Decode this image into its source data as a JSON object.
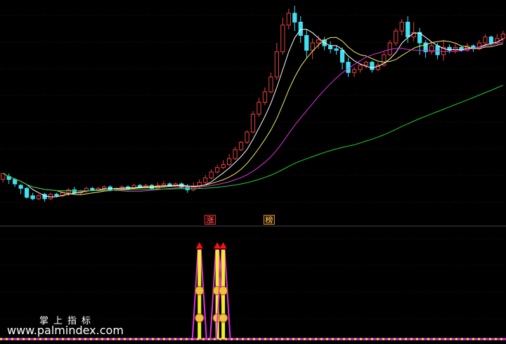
{
  "chart_data": {
    "type": "candlestick",
    "upper_panel": {
      "ylim": [
        0,
        100
      ],
      "grid": true,
      "colors": {
        "up": "#e84040",
        "down": "#40e0f0",
        "ma5": "#ffffff",
        "ma10": "#f0f060",
        "ma20": "#e030e0",
        "ma60": "#20d030"
      },
      "candles": [
        [
          66,
          70,
          64,
          68
        ],
        [
          68,
          66,
          63,
          70
        ],
        [
          66,
          63,
          61,
          67
        ],
        [
          62,
          60,
          56,
          63
        ],
        [
          60,
          54,
          53,
          61
        ],
        [
          55,
          53,
          52,
          57
        ],
        [
          53,
          55,
          52,
          56
        ],
        [
          56,
          53,
          51,
          57
        ],
        [
          53,
          56,
          52,
          57
        ],
        [
          56,
          55,
          54,
          57
        ],
        [
          55,
          57,
          54,
          58
        ],
        [
          57,
          59,
          55,
          60
        ],
        [
          59,
          57,
          56,
          61
        ],
        [
          57,
          58,
          56,
          59
        ],
        [
          58,
          60,
          57,
          61
        ],
        [
          60,
          59,
          58,
          61
        ],
        [
          59,
          60,
          58,
          61
        ],
        [
          60,
          61,
          59,
          62
        ],
        [
          61,
          59,
          58,
          62
        ],
        [
          59,
          60,
          58,
          61
        ],
        [
          60,
          61,
          59,
          62
        ],
        [
          61,
          60,
          59,
          62
        ],
        [
          60,
          62,
          59,
          63
        ],
        [
          62,
          61,
          60,
          63
        ],
        [
          61,
          62,
          60,
          63
        ],
        [
          62,
          60,
          59,
          63
        ],
        [
          60,
          62,
          59,
          64
        ],
        [
          62,
          63,
          61,
          65
        ],
        [
          63,
          62,
          61,
          64
        ],
        [
          62,
          63,
          61,
          64
        ],
        [
          63,
          61,
          60,
          64
        ],
        [
          61,
          59,
          57,
          63
        ],
        [
          59,
          61,
          58,
          64
        ],
        [
          61,
          64,
          60,
          66
        ],
        [
          64,
          67,
          63,
          69
        ],
        [
          67,
          71,
          66,
          73
        ],
        [
          71,
          74,
          70,
          76
        ],
        [
          74,
          76,
          73,
          79
        ],
        [
          76,
          80,
          75,
          83
        ],
        [
          80,
          86,
          79,
          88
        ],
        [
          86,
          91,
          85,
          92
        ],
        [
          91,
          98,
          90,
          99
        ],
        [
          98,
          110,
          97,
          112
        ],
        [
          110,
          118,
          108,
          121
        ],
        [
          118,
          125,
          116,
          128
        ],
        [
          125,
          135,
          124,
          138
        ],
        [
          135,
          152,
          133,
          158
        ],
        [
          152,
          170,
          150,
          175
        ],
        [
          170,
          178,
          167,
          181
        ],
        [
          178,
          172,
          166,
          183
        ],
        [
          172,
          163,
          158,
          176
        ],
        [
          163,
          153,
          148,
          167
        ],
        [
          153,
          158,
          147,
          161
        ],
        [
          158,
          160,
          154,
          163
        ],
        [
          160,
          156,
          153,
          162
        ],
        [
          156,
          154,
          151,
          159
        ],
        [
          154,
          153,
          150,
          156
        ],
        [
          153,
          145,
          140,
          155
        ],
        [
          145,
          138,
          135,
          148
        ],
        [
          138,
          140,
          135,
          142
        ],
        [
          140,
          143,
          138,
          144
        ],
        [
          143,
          145,
          141,
          146
        ],
        [
          145,
          140,
          138,
          146
        ],
        [
          140,
          143,
          139,
          145
        ],
        [
          143,
          150,
          142,
          152
        ],
        [
          150,
          158,
          149,
          160
        ],
        [
          158,
          166,
          156,
          168
        ],
        [
          166,
          172,
          163,
          174
        ],
        [
          172,
          162,
          158,
          176
        ],
        [
          162,
          165,
          159,
          172
        ],
        [
          165,
          158,
          150,
          168
        ],
        [
          158,
          152,
          148,
          160
        ],
        [
          152,
          156,
          150,
          158
        ],
        [
          156,
          150,
          147,
          158
        ],
        [
          150,
          155,
          146,
          160
        ],
        [
          155,
          153,
          151,
          157
        ],
        [
          153,
          155,
          151,
          157
        ],
        [
          155,
          153,
          152,
          156
        ],
        [
          153,
          156,
          152,
          158
        ],
        [
          156,
          154,
          152,
          157
        ],
        [
          154,
          158,
          153,
          160
        ],
        [
          158,
          162,
          156,
          164
        ],
        [
          162,
          158,
          156,
          163
        ],
        [
          158,
          161,
          157,
          164
        ],
        [
          161,
          164,
          159,
          166
        ]
      ]
    },
    "lower_panel": {
      "signals": [
        {
          "bar": 33,
          "level": 1
        },
        {
          "bar": 36,
          "level": 1
        },
        {
          "bar": 37,
          "level": 1
        }
      ]
    }
  },
  "labels": {
    "badge_1": "涨",
    "badge_2": "榜",
    "brand": "掌上指标",
    "watermark": "www.palmindex.com"
  }
}
